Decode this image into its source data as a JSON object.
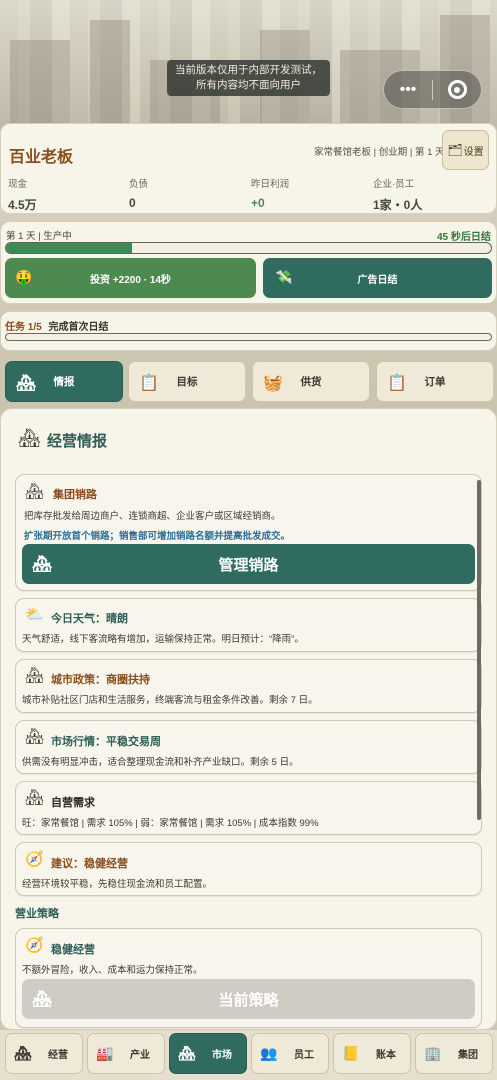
{
  "notice": {
    "line1": "当前版本仅用于内部开发测试，",
    "line2": "所有内容均不面向用户"
  },
  "capsule": {
    "more": "•••"
  },
  "header": {
    "title": "百业老板",
    "subinfo": "家常餐馆老板 | 创业期 | 第 1 天",
    "settings_label": "设置",
    "stats": [
      {
        "label": "现金",
        "value": "4.5万"
      },
      {
        "label": "负债",
        "value": "0"
      },
      {
        "label": "昨日利润",
        "value": "+0"
      },
      {
        "label": "企业·员工",
        "value": "1家・0人"
      }
    ]
  },
  "production": {
    "day_label": "第 1 天 | 生产中",
    "countdown": "45 秒后日结",
    "progress": 0.26,
    "invest_label": "投资 +2200 · 14秒",
    "ad_label": "广告日结"
  },
  "task": {
    "count": "任务 1/5",
    "name": "完成首次日结"
  },
  "tabs": [
    {
      "label": "情报",
      "icon": "building-icon"
    },
    {
      "label": "目标",
      "icon": "clipboard-icon"
    },
    {
      "label": "供货",
      "icon": "crate-icon"
    },
    {
      "label": "订单",
      "icon": "clipboard-icon"
    }
  ],
  "intel": {
    "section_title": "经营情报",
    "channel": {
      "title": "集团销路",
      "desc": "把库存批发给周边商户、连锁商超、企业客户或区域经销商。",
      "note": "扩张期开放首个销路；销售部可增加销路名额并提高批发成交。",
      "button": "管理销路"
    },
    "weather": {
      "title": "今日天气：晴朗",
      "desc": "天气舒适，线下客流略有增加，运输保持正常。明日预计：“降雨”。"
    },
    "policy": {
      "title": "城市政策：商圈扶持",
      "desc": "城市补贴社区门店和生活服务，终端客流与租金条件改善。剩余 7 日。"
    },
    "market": {
      "title": "市场行情：平稳交易周",
      "desc": "供需没有明显冲击，适合整理现金流和补齐产业缺口。剩余 5 日。"
    },
    "demand": {
      "title": "自营需求",
      "desc": "旺：家常餐馆 | 需求 105% | 弱：家常餐馆 | 需求 105% | 成本指数 99%"
    },
    "advice": {
      "title": "建议：稳健经营",
      "desc": "经营环境较平稳，先稳住现金流和员工配置。"
    }
  },
  "strategy": {
    "heading": "营业策略",
    "current": {
      "title": "稳健经营",
      "desc": "不额外冒险，收入、成本和运力保持正常。",
      "button": "当前策略"
    }
  },
  "bottom_nav": [
    {
      "label": "经营",
      "icon": "building-icon"
    },
    {
      "label": "产业",
      "icon": "factory-icon"
    },
    {
      "label": "市场",
      "icon": "market-icon"
    },
    {
      "label": "员工",
      "icon": "staff-icon"
    },
    {
      "label": "账本",
      "icon": "ledger-icon"
    },
    {
      "label": "集团",
      "icon": "tower-icon"
    }
  ],
  "colors": {
    "brand_green": "#2f6b5e",
    "accent_brown": "#8a4e1f",
    "invest_green": "#4c8a50",
    "countdown_green": "#2f7a3b"
  }
}
